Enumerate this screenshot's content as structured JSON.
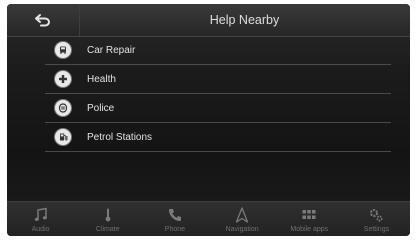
{
  "header": {
    "title": "Help Nearby",
    "back_icon": "back-arrow-icon"
  },
  "list": {
    "items": [
      {
        "label": "Car Repair",
        "icon": "car-icon"
      },
      {
        "label": "Health",
        "icon": "health-cross-icon"
      },
      {
        "label": "Police",
        "icon": "police-icon"
      },
      {
        "label": "Petrol Stations",
        "icon": "fuel-pump-icon"
      }
    ]
  },
  "bottom_nav": {
    "items": [
      {
        "label": "Audio",
        "icon": "music-note-icon"
      },
      {
        "label": "Climate",
        "icon": "temperature-icon"
      },
      {
        "label": "Phone",
        "icon": "phone-icon"
      },
      {
        "label": "Navigation",
        "icon": "navigation-icon"
      },
      {
        "label": "Mobile apps",
        "icon": "apps-grid-icon"
      },
      {
        "label": "Settings",
        "icon": "settings-gears-icon"
      }
    ]
  },
  "colors": {
    "icon_active": "#e8e8e8",
    "nav_icon": "#7a7a7a",
    "nav_label": "#6f6f6f"
  }
}
